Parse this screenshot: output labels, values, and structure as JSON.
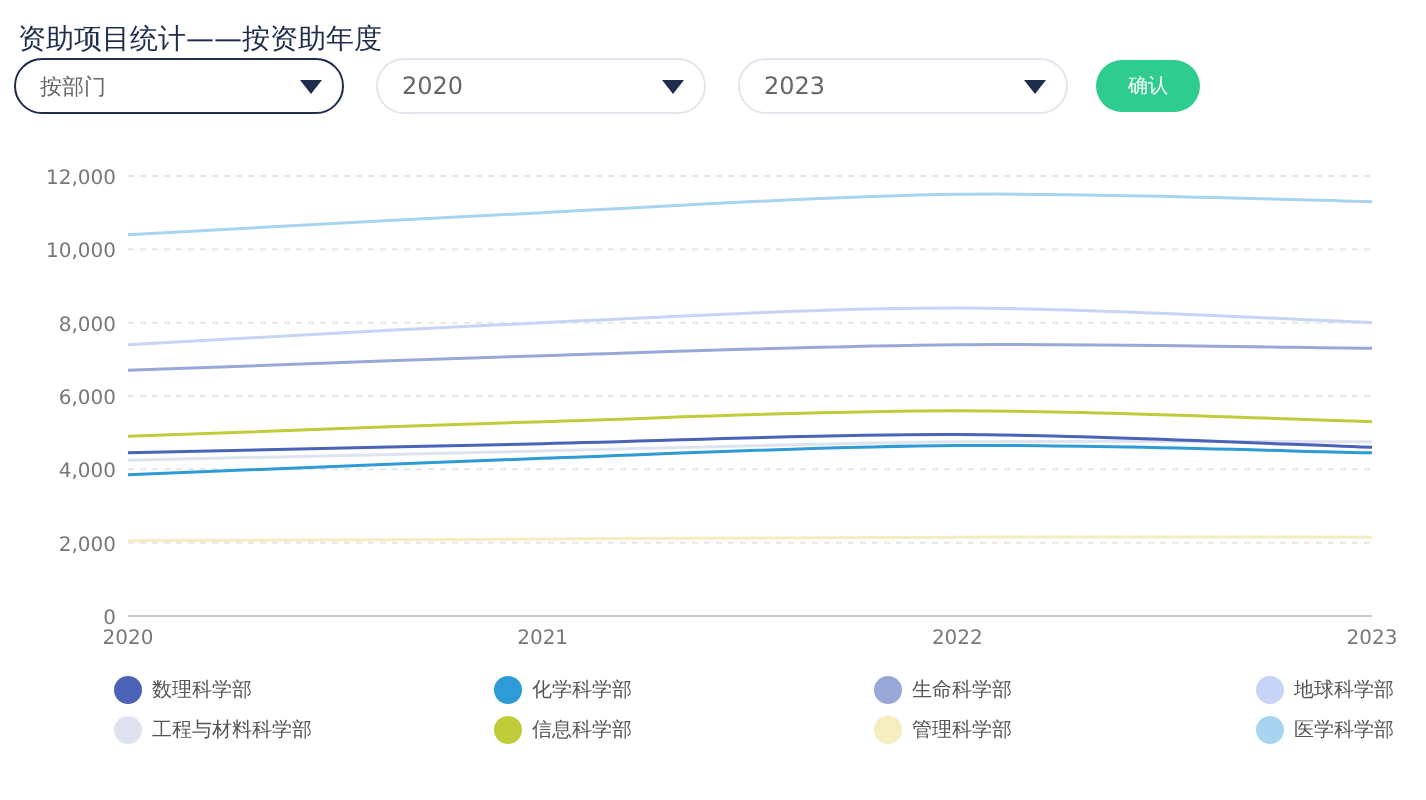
{
  "title": "资助项目统计——按资助年度",
  "filters": [
    {
      "value": "按部门",
      "focused": true
    },
    {
      "value": "2020",
      "focused": false
    },
    {
      "value": "2023",
      "focused": false
    }
  ],
  "confirm_button": "确认",
  "chart_data": {
    "type": "line",
    "grid": true,
    "x": [
      "2020",
      "2021",
      "2022",
      "2023"
    ],
    "ylim": [
      0,
      12000
    ],
    "yticks": [
      {
        "value": 0,
        "label": "0"
      },
      {
        "value": 2000,
        "label": "2,000"
      },
      {
        "value": 4000,
        "label": "4,000"
      },
      {
        "value": 6000,
        "label": "6,000"
      },
      {
        "value": 8000,
        "label": "8,000"
      },
      {
        "value": 10000,
        "label": "10,000"
      },
      {
        "value": 12000,
        "label": "12,000"
      }
    ],
    "series": [
      {
        "name": "数理科学部",
        "color": "#4a62b8",
        "values": [
          4450,
          4700,
          4950,
          4600
        ]
      },
      {
        "name": "化学科学部",
        "color": "#2e9ad6",
        "values": [
          3850,
          4300,
          4650,
          4450
        ]
      },
      {
        "name": "生命科学部",
        "color": "#9aa8d8",
        "values": [
          6700,
          7100,
          7400,
          7300
        ]
      },
      {
        "name": "地球科学部",
        "color": "#c8d4f5",
        "values": [
          7400,
          8000,
          8400,
          8000
        ]
      },
      {
        "name": "工程与材料科学部",
        "color": "#dfe3f0",
        "values": [
          4250,
          4500,
          4750,
          4750
        ]
      },
      {
        "name": "信息科学部",
        "color": "#c0cc3a",
        "values": [
          4900,
          5300,
          5600,
          5300
        ]
      },
      {
        "name": "管理科学部",
        "color": "#f5ecc0",
        "values": [
          2050,
          2100,
          2150,
          2150
        ]
      },
      {
        "name": "医学科学部",
        "color": "#a8d4ef",
        "values": [
          10400,
          11000,
          11500,
          11300
        ]
      }
    ]
  }
}
